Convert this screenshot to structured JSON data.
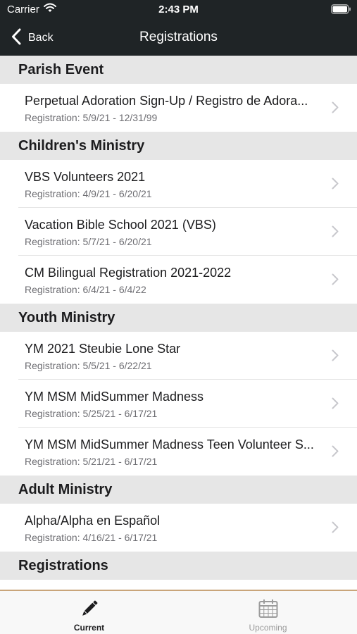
{
  "status_bar": {
    "carrier": "Carrier",
    "time": "2:43 PM"
  },
  "nav": {
    "back_label": "Back",
    "title": "Registrations"
  },
  "sections": [
    {
      "title": "Parish Event",
      "items": [
        {
          "title": "Perpetual Adoration Sign-Up / Registro de Adora...",
          "subtitle": "Registration: 5/9/21 - 12/31/99"
        }
      ]
    },
    {
      "title": "Children's Ministry",
      "items": [
        {
          "title": "VBS Volunteers 2021",
          "subtitle": "Registration: 4/9/21 - 6/20/21"
        },
        {
          "title": "Vacation Bible School 2021 (VBS)",
          "subtitle": "Registration: 5/7/21 - 6/20/21"
        },
        {
          "title": "CM Bilingual Registration 2021-2022",
          "subtitle": "Registration: 6/4/21 - 6/4/22"
        }
      ]
    },
    {
      "title": "Youth Ministry",
      "items": [
        {
          "title": "YM 2021 Steubie Lone Star",
          "subtitle": "Registration: 5/5/21 - 6/22/21"
        },
        {
          "title": "YM MSM MidSummer Madness",
          "subtitle": "Registration: 5/25/21 - 6/17/21"
        },
        {
          "title": "YM MSM MidSummer Madness Teen Volunteer S...",
          "subtitle": "Registration: 5/21/21 - 6/17/21"
        }
      ]
    },
    {
      "title": "Adult Ministry",
      "items": [
        {
          "title": "Alpha/Alpha en Español",
          "subtitle": "Registration: 4/16/21 - 6/17/21"
        }
      ]
    },
    {
      "title": "Registrations",
      "items": []
    }
  ],
  "tabbar": {
    "current": {
      "label": "Current",
      "icon": "pencil-icon"
    },
    "upcoming": {
      "label": "Upcoming",
      "icon": "calendar-icon"
    }
  },
  "colors": {
    "nav_background": "#1f2426",
    "section_background": "#e6e6e6",
    "tabbar_accent": "#c9a57a",
    "inactive_tab": "#9b9b9b"
  }
}
